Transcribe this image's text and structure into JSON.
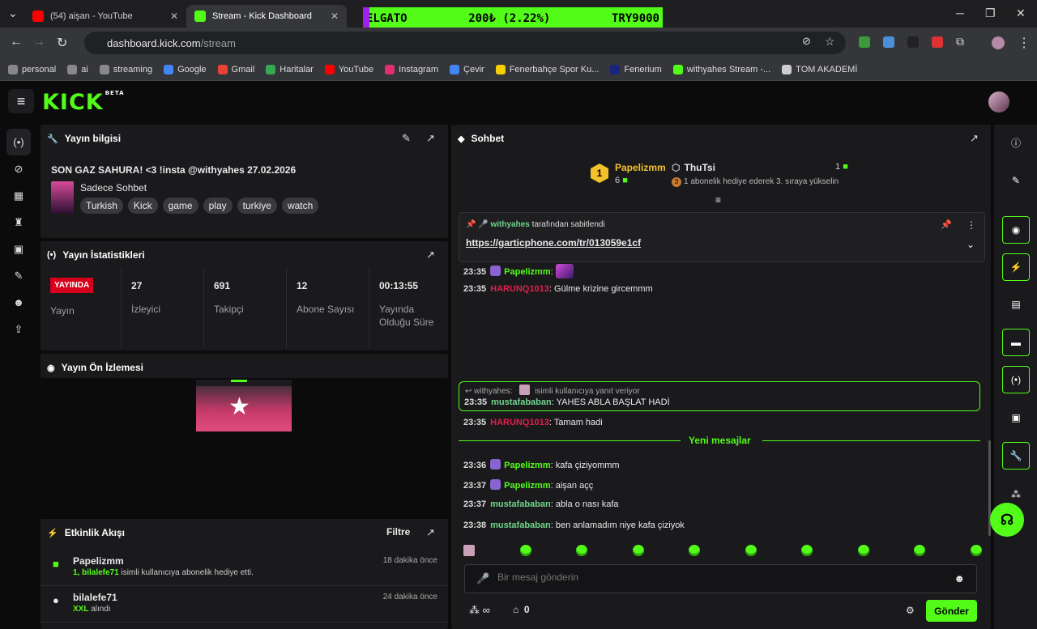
{
  "browser": {
    "tabs": [
      {
        "title": "(54) aişan - YouTube",
        "color": "#ff0000"
      },
      {
        "title": "Stream - Kick Dashboard",
        "color": "#53fc18"
      },
      {
        "title": "",
        "color": "#a020f0"
      }
    ],
    "ticker": {
      "left": "ELGATO",
      "middle": "200₺ (2.22%)",
      "right": "TRY9000"
    },
    "url_host": "dashboard.kick.com",
    "url_path": "/stream",
    "bookmarks": [
      {
        "label": "personal",
        "color": "#888"
      },
      {
        "label": "ai",
        "color": "#888"
      },
      {
        "label": "streaming",
        "color": "#888"
      },
      {
        "label": "Google",
        "color": "#4285f4"
      },
      {
        "label": "Gmail",
        "color": "#ea4335"
      },
      {
        "label": "Haritalar",
        "color": "#34a853"
      },
      {
        "label": "YouTube",
        "color": "#ff0000"
      },
      {
        "label": "Instagram",
        "color": "#e1306c"
      },
      {
        "label": "Çevir",
        "color": "#4285f4"
      },
      {
        "label": "Fenerbahçe Spor Ku...",
        "color": "#f5d000"
      },
      {
        "label": "Fenerium",
        "color": "#1a237e"
      },
      {
        "label": "withyahes Stream -...",
        "color": "#53fc18"
      },
      {
        "label": "TOM AKADEMİ",
        "color": "#ccc"
      }
    ]
  },
  "app": {
    "logo": "KICK",
    "logo_badge": "BETA"
  },
  "info": {
    "header": "Yayın bilgisi",
    "title": "SON GAZ SAHURA! <3 !insta @withyahes 27.02.2026",
    "category": "Sadece Sohbet",
    "tags": [
      "Turkish",
      "Kick",
      "game",
      "play",
      "turkiye",
      "watch"
    ]
  },
  "stats": {
    "header": "Yayın İstatistikleri",
    "live_badge": "YAYINDA",
    "live_label": "Yayın",
    "viewers": "27",
    "viewers_label": "İzleyici",
    "followers": "691",
    "followers_label": "Takipçi",
    "subs": "12",
    "subs_label": "Abone Sayısı",
    "duration": "00:13:55",
    "duration_label_1": "Yayında",
    "duration_label_2": "Olduğu Süre"
  },
  "preview": {
    "header": "Yayın Ön İzlemesi"
  },
  "activity": {
    "header": "Etkinlik Akışı",
    "filter": "Filtre",
    "items": [
      {
        "name": "Papelizmm",
        "detail_bold": "1, bilalefe71",
        "detail": " isimli kullanıcıya abonelik hediye etti.",
        "time": "18 dakika önce"
      },
      {
        "name": "bilalefe71",
        "detail_bold": "XXL",
        "detail": " alındı",
        "time": "24 dakika önce"
      }
    ]
  },
  "chat": {
    "header": "Sohbet",
    "gifter1": {
      "rank": "1",
      "name": "Papelizmm",
      "count": "6"
    },
    "gifter2": {
      "name": "ThuTsi",
      "count": "1",
      "note": "1 abonelik hediye ederek 3. sıraya yükselin",
      "rank": "3"
    },
    "pinned_by": "withyahes",
    "pinned_suffix": "tarafından sabitlendi",
    "pinned_link": "https://garticphone.com/tr/013059e1cf",
    "messages": [
      {
        "time": "23:35",
        "user": "Papelizmm",
        "text": ""
      },
      {
        "time": "23:35",
        "user": "HARUNQ1013",
        "text": "Gülme krizine gircemmm"
      },
      {
        "time": "23:35",
        "user": "mustafababan",
        "text": "YAHES ABLA BAŞLAT HADİ"
      },
      {
        "time": "23:35",
        "user": "HARUNQ1013",
        "text": "Tamam hadi"
      },
      {
        "time": "23:36",
        "user": "Papelizmm",
        "text": "kafa çiziyommm"
      },
      {
        "time": "23:37",
        "user": "Papelizmm",
        "text": "aişan açç"
      },
      {
        "time": "23:37",
        "user": "mustafababan",
        "text": "abla o nası kafa"
      },
      {
        "time": "23:38",
        "user": "mustafababan",
        "text": "ben anlamadım niye kafa çiziyok"
      }
    ],
    "reply_to": "withyahes:",
    "reply_note": "isimli kullanıcıya yanıt veriyor",
    "new_messages": "Yeni mesajlar",
    "input_placeholder": "Bir mesaj gönderin",
    "points": "∞",
    "store_count": "0",
    "send": "Gönder"
  }
}
